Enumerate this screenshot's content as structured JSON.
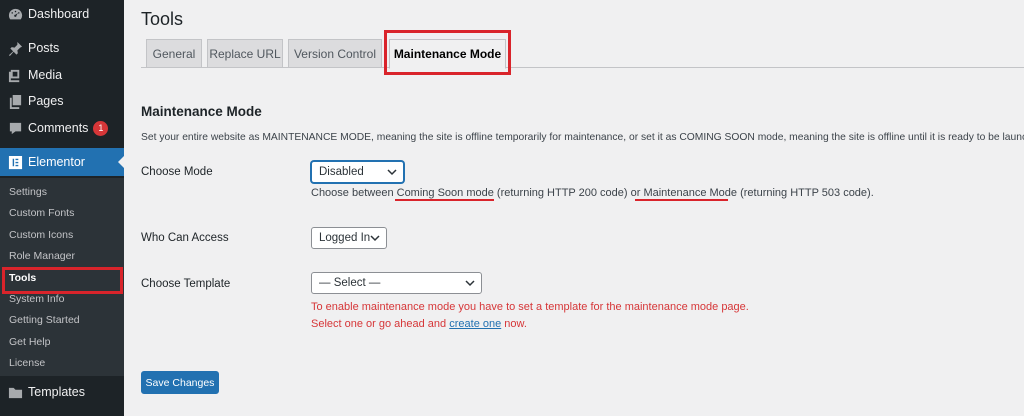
{
  "sidebar": {
    "items": [
      {
        "label": "Dashboard",
        "icon": "dashboard-icon"
      },
      {
        "label": "Posts",
        "icon": "pin-icon"
      },
      {
        "label": "Media",
        "icon": "media-icon"
      },
      {
        "label": "Pages",
        "icon": "pages-icon"
      },
      {
        "label": "Comments",
        "icon": "comment-icon",
        "badge": "1"
      },
      {
        "label": "Elementor",
        "icon": "elementor-icon"
      },
      {
        "label": "Templates",
        "icon": "folder-icon"
      }
    ],
    "elementor_submenu": [
      "Settings",
      "Custom Fonts",
      "Custom Icons",
      "Role Manager",
      "Tools",
      "System Info",
      "Getting Started",
      "Get Help",
      "License"
    ]
  },
  "page": {
    "title": "Tools",
    "tabs": [
      "General",
      "Replace URL",
      "Version Control",
      "Maintenance Mode"
    ],
    "active_tab": "Maintenance Mode"
  },
  "maintenance": {
    "section_title": "Maintenance Mode",
    "description": "Set your entire website as MAINTENANCE MODE, meaning the site is offline temporarily for maintenance, or set it as COMING SOON mode, meaning the site is offline until it is ready to be launched.",
    "choose_mode": {
      "label": "Choose Mode",
      "value": "Disabled",
      "help_prefix": "Choose between ",
      "help_link1": "Coming Soon mode",
      "help_mid": " (returning HTTP 200 code) or ",
      "help_link2": "Maintenance Mode",
      "help_suffix": " (returning HTTP 503 code)."
    },
    "who_can_access": {
      "label": "Who Can Access",
      "value": "Logged In"
    },
    "choose_template": {
      "label": "Choose Template",
      "value": "— Select —",
      "error_line1": "To enable maintenance mode you have to set a template for the maintenance mode page.",
      "error_line2_prefix": "Select one or go ahead and ",
      "error_link": "create one",
      "error_line2_suffix": " now."
    },
    "save_label": "Save Changes"
  },
  "colors": {
    "accent": "#2271b1",
    "highlight": "#d9242b",
    "sidebar_bg": "#1d2327"
  }
}
